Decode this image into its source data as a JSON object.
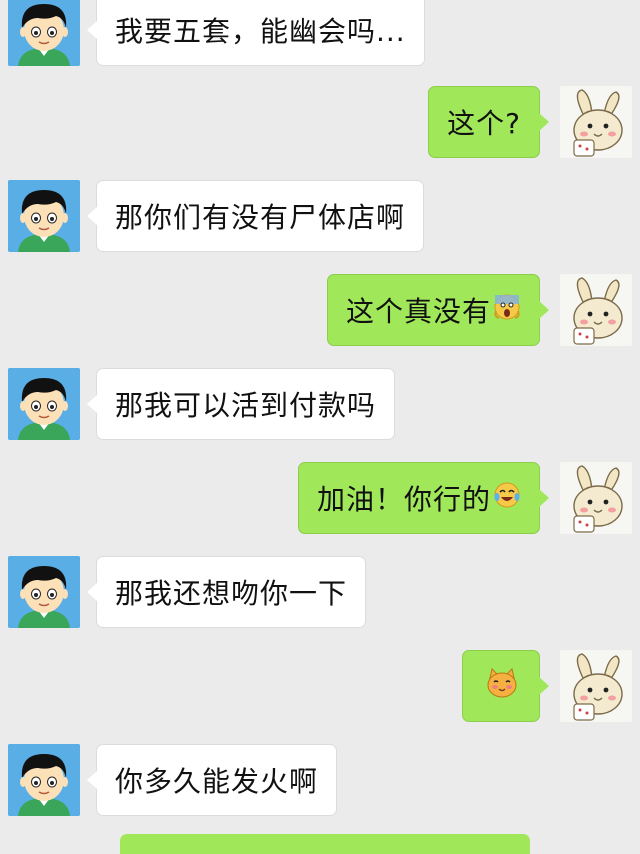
{
  "conversation": {
    "messages": [
      {
        "side": "incoming",
        "sender": "boy",
        "text": "我要五套，能幽会吗..."
      },
      {
        "side": "outgoing",
        "sender": "bunny",
        "text": "这个?"
      },
      {
        "side": "incoming",
        "sender": "boy",
        "text": "那你们有没有尸体店啊"
      },
      {
        "side": "outgoing",
        "sender": "bunny",
        "text": "这个真没有",
        "emoji": "scream-emoji"
      },
      {
        "side": "incoming",
        "sender": "boy",
        "text": "那我可以活到付款吗"
      },
      {
        "side": "outgoing",
        "sender": "bunny",
        "text": "加油！你行的",
        "emoji": "tears-of-joy-emoji"
      },
      {
        "side": "incoming",
        "sender": "boy",
        "text": "那我还想吻你一下"
      },
      {
        "side": "outgoing",
        "sender": "bunny",
        "text": "",
        "emoji": "shy-cat-emoji"
      },
      {
        "side": "incoming",
        "sender": "boy",
        "text": "你多久能发火啊"
      }
    ]
  },
  "colors": {
    "background": "#ebebeb",
    "incoming_bubble": "#ffffff",
    "outgoing_bubble": "#a0e75a",
    "boy_avatar_bg": "#5aaee6"
  },
  "icons": {
    "boy_avatar": "cartoon-boy-avatar",
    "bunny_avatar": "cartoon-bunny-avatar"
  }
}
